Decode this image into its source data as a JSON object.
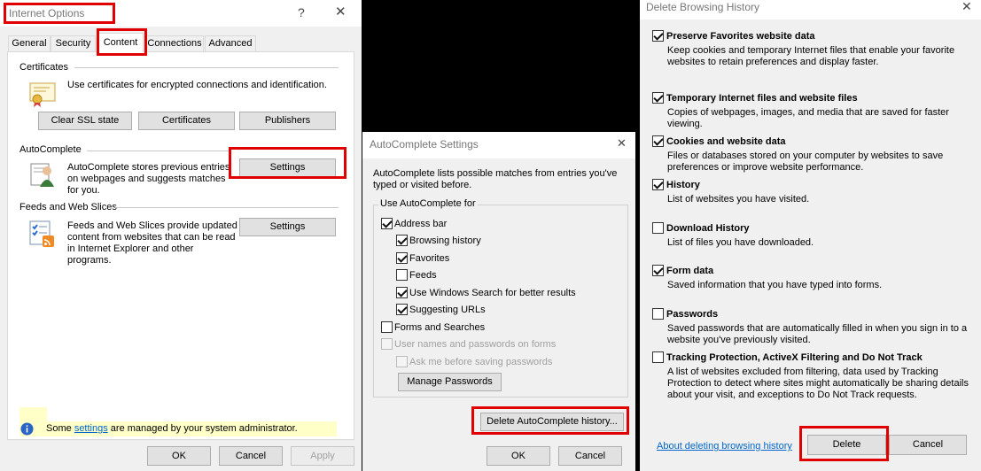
{
  "internet_options": {
    "title": "Internet Options",
    "tabs": [
      "General",
      "Security",
      "Content",
      "Connections",
      "Advanced"
    ],
    "certificates": {
      "heading": "Certificates",
      "description": "Use certificates for encrypted connections and identification.",
      "clear_ssl": "Clear SSL state",
      "certificates_btn": "Certificates",
      "publishers_btn": "Publishers"
    },
    "autocomplete": {
      "heading": "AutoComplete",
      "description": "AutoComplete stores previous entries on webpages and suggests matches for you.",
      "settings_btn": "Settings"
    },
    "feeds": {
      "heading": "Feeds and Web Slices",
      "description": "Feeds and Web Slices provide updated content from websites that can be read in Internet Explorer and other programs.",
      "settings_btn": "Settings"
    },
    "admin_note_prefix": "Some",
    "admin_note_link": "settings",
    "admin_note_suffix": "are managed by your system administrator.",
    "ok": "OK",
    "cancel": "Cancel",
    "apply": "Apply"
  },
  "autocomplete_settings": {
    "title": "AutoComplete Settings",
    "intro": "AutoComplete lists possible matches from entries you've typed or visited before.",
    "group_label": "Use AutoComplete for",
    "address_bar": "Address bar",
    "browsing_history": "Browsing history",
    "favorites": "Favorites",
    "feeds": "Feeds",
    "windows_search": "Use Windows Search for better results",
    "suggesting_urls": "Suggesting URLs",
    "forms_searches": "Forms and Searches",
    "usernames_passwords": "User names and passwords on forms",
    "ask_before_saving": "Ask me before saving passwords",
    "manage_passwords": "Manage Passwords",
    "delete_history": "Delete AutoComplete history...",
    "ok": "OK",
    "cancel": "Cancel"
  },
  "delete_browsing_history": {
    "title": "Delete Browsing History",
    "items": [
      {
        "label": "Preserve Favorites website data",
        "desc": "Keep cookies and temporary Internet files that enable your favorite websites to retain preferences and display faster.",
        "checked": true
      },
      {
        "label": "Temporary Internet files and website files",
        "desc": "Copies of webpages, images, and media that are saved for faster viewing.",
        "checked": true
      },
      {
        "label": "Cookies and website data",
        "desc": "Files or databases stored on your computer by websites to save preferences or improve website performance.",
        "checked": true
      },
      {
        "label": "History",
        "desc": "List of websites you have visited.",
        "checked": true
      },
      {
        "label": "Download History",
        "desc": "List of files you have downloaded.",
        "checked": false
      },
      {
        "label": "Form data",
        "desc": "Saved information that you have typed into forms.",
        "checked": true
      },
      {
        "label": "Passwords",
        "desc": "Saved passwords that are automatically filled in when you sign in to a website you've previously visited.",
        "checked": false
      },
      {
        "label": "Tracking Protection, ActiveX Filtering and Do Not Track",
        "desc": "A list of websites excluded from filtering, data used by Tracking Protection to detect where sites might automatically be sharing details about your visit, and exceptions to Do Not Track requests.",
        "checked": false
      }
    ],
    "about_link": "About deleting browsing history",
    "delete": "Delete",
    "cancel": "Cancel"
  },
  "colors": {
    "highlight_red": "#e00000",
    "link_blue": "#0066cc",
    "info_bar": "#ffffc8"
  }
}
